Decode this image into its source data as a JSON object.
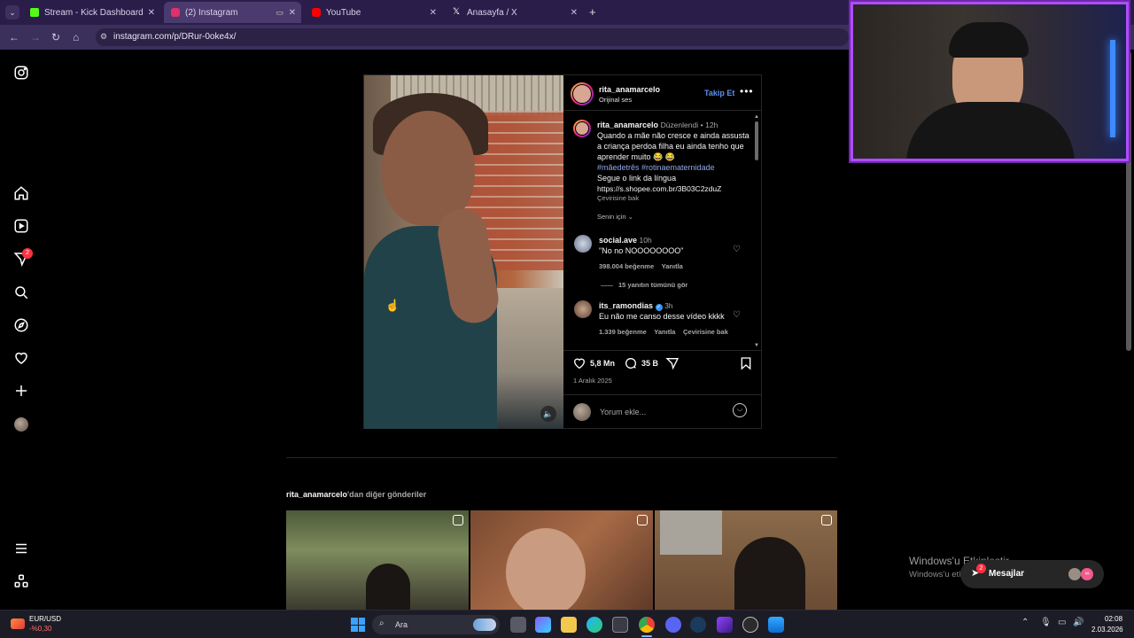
{
  "browser": {
    "tabs": [
      {
        "title": "Stream - Kick Dashboard",
        "color": "#53fc18"
      },
      {
        "title": "(2) Instagram",
        "color": "#e1306c"
      },
      {
        "title": "YouTube",
        "color": "#ff0000"
      },
      {
        "title": "Anasayfa / X",
        "color": "#ffffff"
      }
    ],
    "url": "instagram.com/p/DRur-0oke4x/"
  },
  "sidebar": {
    "notification_count": "2"
  },
  "post": {
    "author": "rita_anamarcelo",
    "audio": "Orijinal ses",
    "follow_label": "Takip Et",
    "caption": {
      "author": "rita_anamarcelo",
      "edited": "Düzenlendi",
      "time": "12h",
      "text1": "Quando a mãe não cresce e ainda assusta a criança perdoa filha eu ainda tenho que aprender muito 😂 😂",
      "tags": "#mãedetrês #rotinaematernidade",
      "text2": "Segue o link da língua",
      "link": "https://s.shopee.com.br/3B03C2zduZ",
      "translate": "Çevirisine bak"
    },
    "for_you": "Senin için",
    "comments": [
      {
        "user": "social.ave",
        "time": "10h",
        "text": "\"No no NOOOOOOOO\"",
        "likes": "398.004 beğenme",
        "reply": "Yanıtla",
        "view_replies": "15 yanıtın tümünü gör"
      },
      {
        "user": "its_ramondias",
        "time": "3h",
        "text": "Eu não me canso desse vídeo kkkk",
        "likes": "1.339 beğenme",
        "reply": "Yanıtla",
        "translate": "Çevirisine bak"
      }
    ],
    "like_count": "5,8 Mn",
    "comment_count": "35 B",
    "date": "1 Aralık 2025",
    "comment_placeholder": "Yorum ekle..."
  },
  "more_posts": {
    "author": "rita_anamarcelo",
    "suffix": "'dan diğer gönderiler"
  },
  "overlay": {
    "windows_title": "Windows'u Etkinleştir",
    "windows_sub": "Windows'u etkinleştirmek için Ayarlar'a gidin.",
    "messages_label": "Mesajlar",
    "messages_badge": "2"
  },
  "taskbar": {
    "ticker_label": "EUR/USD",
    "ticker_value": "-%0,30",
    "search_label": "Ara",
    "time": "02:08",
    "date": "2.03.2026"
  }
}
